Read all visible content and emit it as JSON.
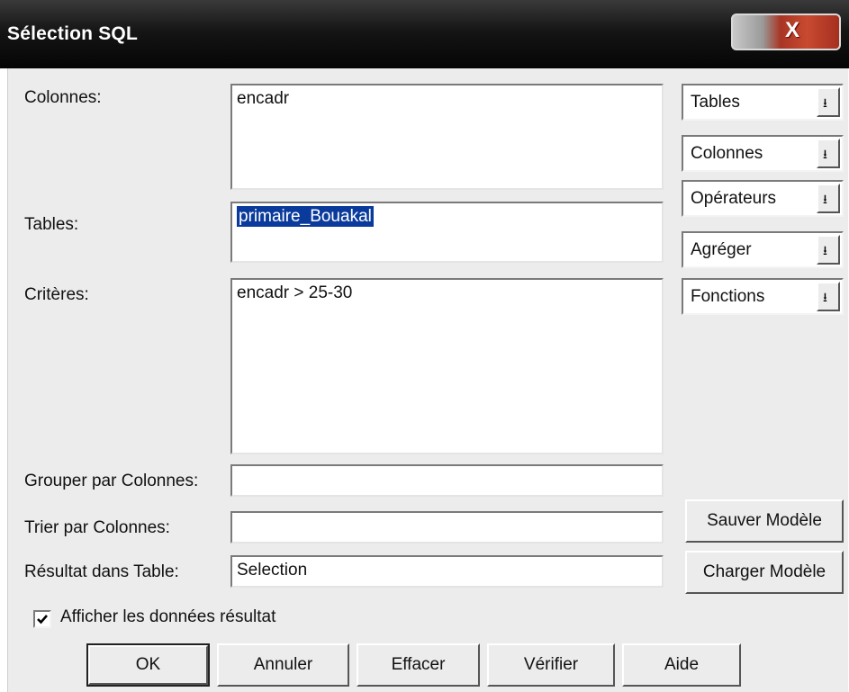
{
  "window": {
    "title": "Sélection SQL",
    "close_glyph": "X"
  },
  "labels": {
    "colonnes": "Colonnes:",
    "tables": "Tables:",
    "criteres": "Critères:",
    "grouper": "Grouper par Colonnes:",
    "trier": "Trier par Colonnes:",
    "resultat": "Résultat dans Table:"
  },
  "fields": {
    "colonnes_value": "encadr",
    "tables_value": "primaire_Bouakal",
    "criteres_value": "encadr > 25-30",
    "grouper_value": "",
    "trier_value": "",
    "resultat_value": "Selection"
  },
  "dropdowns": [
    {
      "label": "Tables"
    },
    {
      "label": "Colonnes"
    },
    {
      "label": "Opérateurs"
    },
    {
      "label": "Agréger"
    },
    {
      "label": "Fonctions"
    }
  ],
  "side_buttons": {
    "save": "Sauver Modèle",
    "load": "Charger Modèle"
  },
  "checkbox": {
    "label": "Afficher les données résultat",
    "checked": true
  },
  "buttons": {
    "ok": "OK",
    "cancel": "Annuler",
    "clear": "Effacer",
    "verify": "Vérifier",
    "help": "Aide"
  },
  "colors": {
    "selection": "#0a3b9c",
    "dialog_bg": "#ececec"
  }
}
